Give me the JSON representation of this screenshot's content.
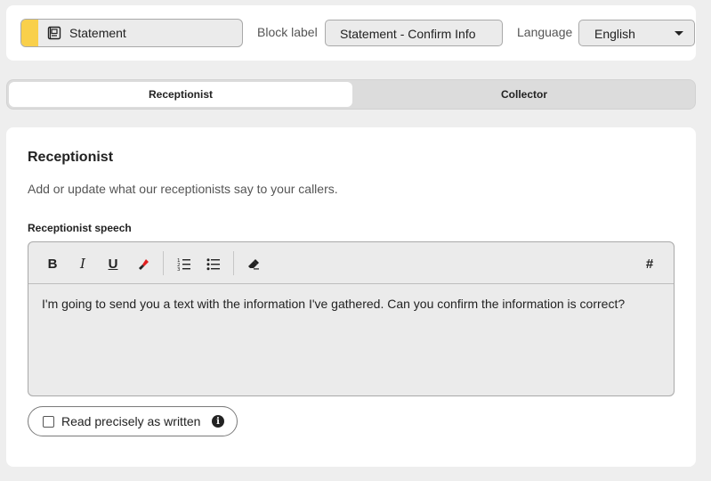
{
  "header": {
    "block_type": {
      "label": "Statement",
      "icon": "book-icon",
      "accent_color": "#f9d04b"
    },
    "block_label": {
      "label": "Block label",
      "value": "Statement - Confirm Info"
    },
    "language": {
      "label": "Language",
      "selected": "English"
    }
  },
  "tabs": [
    {
      "label": "Receptionist",
      "active": true
    },
    {
      "label": "Collector",
      "active": false
    }
  ],
  "section": {
    "title": "Receptionist",
    "description": "Add or update what our receptionists say to your callers.",
    "speech_label": "Receptionist speech",
    "toolbar": {
      "bold": "B",
      "italic": "I",
      "underline": "U",
      "variable": "#"
    },
    "speech_text": "I'm going to send you a text with the information I've gathered. Can you confirm the information is correct?",
    "read_precisely": {
      "label": "Read precisely as written",
      "checked": false,
      "info": "i"
    }
  }
}
